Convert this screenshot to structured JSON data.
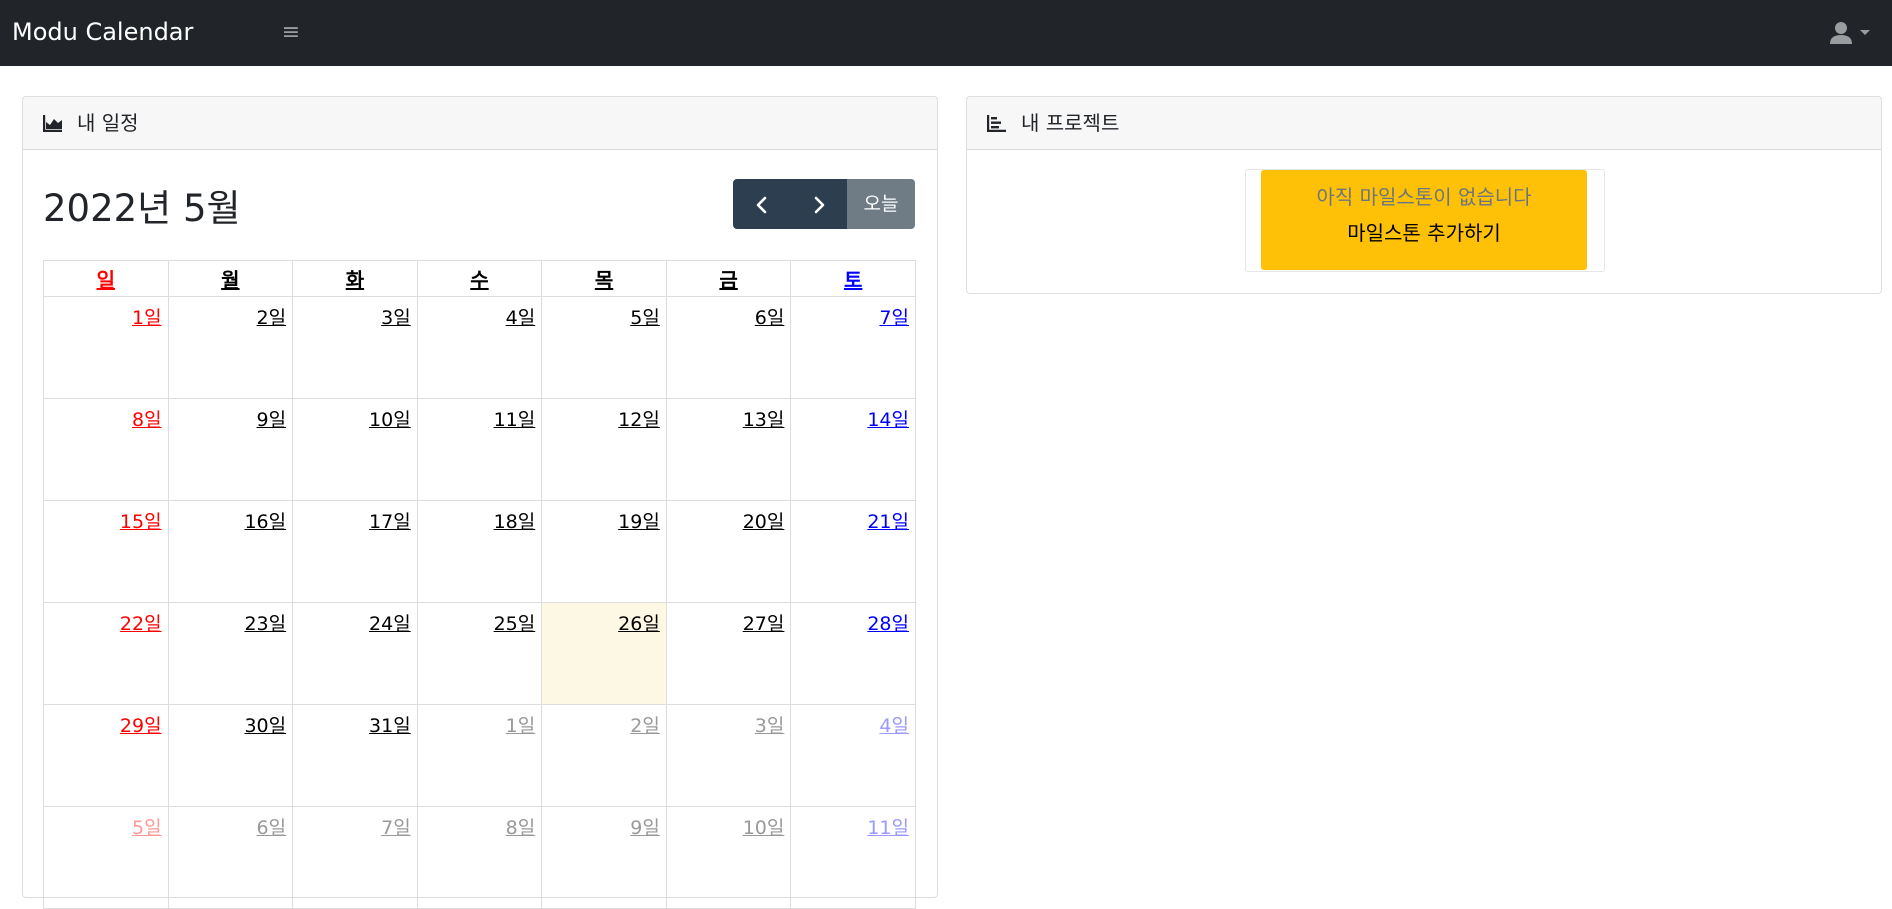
{
  "app": {
    "brand": "Modu Calendar"
  },
  "navbar": {
    "menu_icon": "hamburger-icon",
    "user_icon": "user-icon",
    "caret_icon": "caret-down-icon"
  },
  "schedule": {
    "header_icon": "area-chart-icon",
    "header_title": "내 일정",
    "title": "2022년 5월",
    "prev_icon": "chevron-left-icon",
    "next_icon": "chevron-right-icon",
    "today_label": "오늘",
    "weekdays": [
      "일",
      "월",
      "화",
      "수",
      "목",
      "금",
      "토"
    ],
    "weeks": [
      [
        "1일",
        "2일",
        "3일",
        "4일",
        "5일",
        "6일",
        "7일"
      ],
      [
        "8일",
        "9일",
        "10일",
        "11일",
        "12일",
        "13일",
        "14일"
      ],
      [
        "15일",
        "16일",
        "17일",
        "18일",
        "19일",
        "20일",
        "21일"
      ],
      [
        "22일",
        "23일",
        "24일",
        "25일",
        "26일",
        "27일",
        "28일"
      ],
      [
        "29일",
        "30일",
        "31일",
        "1일",
        "2일",
        "3일",
        "4일"
      ],
      [
        "5일",
        "6일",
        "7일",
        "8일",
        "9일",
        "10일",
        "11일"
      ]
    ],
    "today": "26일",
    "colors": {
      "sunday": "#ff0000",
      "saturday": "#0000ff",
      "weekday": "#000000",
      "today_bg": "#fcf8e3"
    }
  },
  "projects": {
    "header_icon": "list-chart-icon",
    "header_title": "내 프로젝트",
    "empty_text": "아직 마일스톤이 없습니다",
    "add_label": "마일스톤 추가하기",
    "accent": "#ffc107"
  }
}
